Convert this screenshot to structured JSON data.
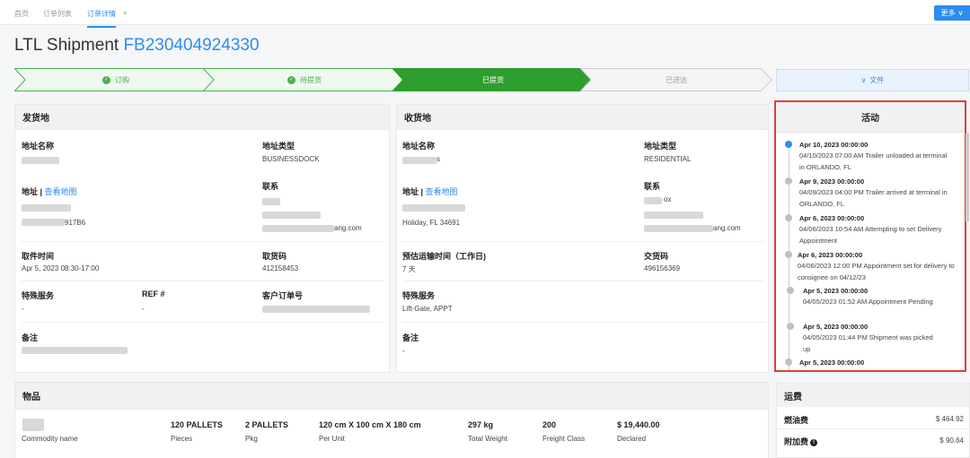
{
  "tabs": [
    {
      "label": "首页"
    },
    {
      "label": "订单列表"
    },
    {
      "label": "订单详情"
    }
  ],
  "tab_close": "×",
  "more_button": {
    "label": "更多",
    "caret": "∨"
  },
  "page": {
    "title": "LTL Shipment",
    "order_no": "FB230404924330"
  },
  "steps": [
    {
      "label": "订购",
      "state": "done"
    },
    {
      "label": "待提货",
      "state": "done"
    },
    {
      "label": "已提货",
      "state": "current"
    },
    {
      "label": "已送达",
      "state": "pending"
    }
  ],
  "step_check": "✓",
  "files_button": {
    "label": "文件",
    "caret": "∨"
  },
  "shipper": {
    "title": "发货地",
    "address_name_label": "地址名称",
    "address_type_label": "地址类型",
    "address_type_value": "BUSINESSDOCK",
    "address_label": "地址",
    "map_link": "查看地图",
    "contact_label": "联系",
    "address_fragment": "917B6",
    "email_fragment": "ang.com",
    "pickup_time_label": "取件时间",
    "pickup_time_value": "Apr 5, 2023 08:30-17:00",
    "pickup_code_label": "取货码",
    "pickup_code_value": "412158453",
    "special_services_label": "特殊服务",
    "special_services_value": "-",
    "ref_label": "REF #",
    "ref_value": "-",
    "customer_order_label": "客户订单号",
    "remarks_label": "备注"
  },
  "consignee": {
    "title": "收货地",
    "address_name_label": "地址名称",
    "address_name_fragment": "s",
    "address_type_label": "地址类型",
    "address_type_value": "RESIDENTIAL",
    "address_label": "地址",
    "map_link": "查看地图",
    "contact_label": "联系",
    "contact_fragment": "ox",
    "address_value": "Holiday, FL 34691",
    "email_fragment": "ang.com",
    "transit_time_label": "预估运输时间（工作日)",
    "transit_time_value": "7 天",
    "delivery_code_label": "交货码",
    "delivery_code_value": "496156369",
    "special_services_label": "特殊服务",
    "special_services_value": "Lift-Gate, APPT",
    "remarks_label": "备注",
    "remarks_value": "-"
  },
  "activity": {
    "title": "活动",
    "events": [
      {
        "date": "Apr 10, 2023 00:00:00",
        "desc": "04/10/2023 07:00 AM Trailer unloaded at terminal in ORLANDO, FL"
      },
      {
        "date": "Apr 9, 2023 00:00:00",
        "desc": "04/09/2023 04:00 PM Trailer arrived at terminal in ORLANDO, FL"
      },
      {
        "date": "Apr 6, 2023 00:00:00",
        "desc": "04/06/2023 10:54 AM Attempting to set Delivery Appointment"
      },
      {
        "date": "Apr 6, 2023 00:00:00",
        "desc": "04/06/2023 12:00 PM Appointment set for delivery to consignee on 04/12/23"
      },
      {
        "date": "Apr 5, 2023 00:00:00",
        "desc": "04/05/2023 01:52 AM Appointment Pending"
      },
      {
        "date": "Apr 5, 2023 00:00:00",
        "desc": "04/05/2023 01:44 PM Shipment was picked up"
      },
      {
        "date": "Apr 5, 2023 00:00:00",
        "desc": ""
      }
    ]
  },
  "items": {
    "title": "物品",
    "row": [
      {
        "value": "",
        "label": "Commodity name"
      },
      {
        "value": "120 PALLETS",
        "label": "Pieces"
      },
      {
        "value": "2 PALLETS",
        "label": "Pkg"
      },
      {
        "value": "120 cm X 100 cm X 180 cm",
        "label": "Per Unit"
      },
      {
        "value": "297 kg",
        "label": "Total Weight"
      },
      {
        "value": "200",
        "label": "Freight Class"
      },
      {
        "value": "$ 19,440.00",
        "label": "Declared"
      }
    ]
  },
  "fees": {
    "title": "运费",
    "rows": [
      {
        "label": "燃油费",
        "value": "$ 464.92"
      },
      {
        "label": "附加费",
        "value": "$ 90.64",
        "info_icon": "!"
      }
    ]
  },
  "colors": {
    "accent": "#2d8cf0",
    "step_done": "#4caf50",
    "step_current": "#2e9e2e",
    "highlight_border": "#e03e36"
  }
}
